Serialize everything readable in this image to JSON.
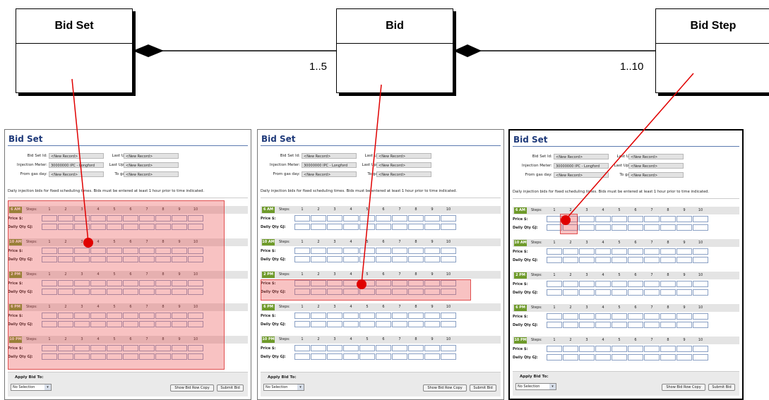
{
  "diagram": {
    "boxes": [
      {
        "id": "bid-set",
        "label": "Bid Set"
      },
      {
        "id": "bid",
        "label": "Bid"
      },
      {
        "id": "bid-step",
        "label": "Bid Step"
      }
    ],
    "multiplicities": {
      "bid_set_bid": "1..5",
      "bid_bid_step": "1..10"
    },
    "colors": {
      "link": "#e00000",
      "marker": "#e00000",
      "highlight": "#f08080"
    }
  },
  "screen": {
    "title": "Bid Set",
    "fields": [
      {
        "label": "Bid Set Id:",
        "value": "<New Record>"
      },
      {
        "label": "Last User Id:",
        "value": "<New Record>"
      },
      {
        "label": "Injection Meter:",
        "value": "30000000 IPC - Longford"
      },
      {
        "label": "Last Updated:",
        "value": "<New Record>"
      },
      {
        "label": "From gas day:",
        "value": "<New Record>"
      },
      {
        "label": "To gas day:",
        "value": "<New Record>"
      }
    ],
    "instructions": "Daily injection bids for fixed scheduling times. Bids must be entered at least 1 hour prior to time indicated.",
    "times": [
      "6 AM",
      "10 AM",
      "2 PM",
      "6 PM",
      "10 PM"
    ],
    "steps_label": "Steps:",
    "steps": [
      "1",
      "2",
      "3",
      "4",
      "5",
      "6",
      "7",
      "8",
      "9",
      "10"
    ],
    "price_label": "Price $:",
    "qty_label": "Daily Qty GJ:",
    "apply_label": "Apply Bid To:",
    "select_value": "No Selection",
    "show_copy_label": "Show Bid Row Copy",
    "submit_label": "Submit Bid"
  }
}
